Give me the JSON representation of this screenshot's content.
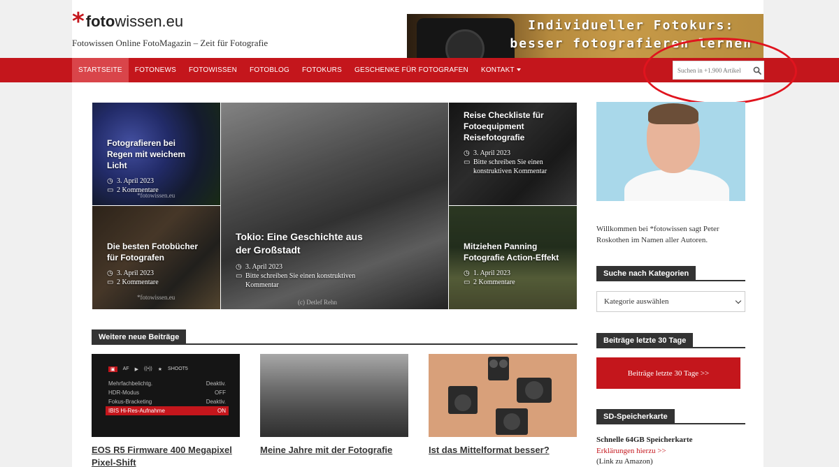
{
  "site": {
    "logo_text": "fotowissen.eu",
    "tagline": "Fotowissen Online FotoMagazin – Zeit für Fotografie"
  },
  "banner": {
    "line1": "Individueller Fotokurs:",
    "line2": "besser fotografieren lernen"
  },
  "nav": {
    "items": [
      {
        "label": "STARTSEITE",
        "active": true
      },
      {
        "label": "FOTONEWS"
      },
      {
        "label": "FOTOWISSEN"
      },
      {
        "label": "FOTOBLOG"
      },
      {
        "label": "FOTOKURS"
      },
      {
        "label": "GESCHENKE FÜR FOTOGRAFEN"
      },
      {
        "label": "KONTAKT"
      }
    ],
    "search_placeholder": "Suchen in +1.900 Artikel"
  },
  "featured": [
    {
      "title": "Fotografieren bei Regen mit weichem Licht",
      "date": "3. April 2023",
      "comments": "2 Kommentare",
      "watermark": "*fotowissen.eu"
    },
    {
      "title": "Die besten Fotobücher für Fotografen",
      "date": "3. April 2023",
      "comments": "2 Kommentare",
      "watermark": "*fotowissen.eu"
    },
    {
      "title": "Tokio: Eine Geschichte aus der Großstadt",
      "date": "3. April 2023",
      "comments": "Bitte schreiben Sie einen konstruktiven Kommentar",
      "watermark": "(c) Detlef Rehn"
    },
    {
      "title": "Reise Checkliste für Fotoequipment Reisefotografie",
      "date": "3. April 2023",
      "comments": "Bitte schreiben Sie einen konstruktiven Kommentar"
    },
    {
      "title": "Mitziehen Panning Fotografie Action-Effekt",
      "date": "1. April 2023",
      "comments": "2 Kommentare"
    }
  ],
  "more_posts": {
    "heading": "Weitere neue Beiträge",
    "cards": [
      {
        "title": "EOS R5 Firmware 400 Megapixel Pixel-Shift"
      },
      {
        "title": "Meine Jahre mit der Fotografie"
      },
      {
        "title": "Ist das Mittelformat besser?"
      }
    ],
    "camera_menu": {
      "tabs": [
        "AF",
        "▶",
        "((•))",
        "★",
        "SHOOT5"
      ],
      "rows": [
        {
          "label": "Mehrfachbelichtg.",
          "value": "Deaktiv."
        },
        {
          "label": "HDR-Modus",
          "value": "OFF"
        },
        {
          "label": "Fokus-Bracketing",
          "value": "Deaktiv."
        },
        {
          "label": "IBIS Hi-Res-Aufnahme",
          "value": "ON",
          "selected": true
        }
      ]
    }
  },
  "sidebar": {
    "welcome": "Willkommen bei *fotowissen sagt Peter Roskothen im Namen aller Autoren.",
    "categories_heading": "Suche nach Kategorien",
    "categories_select": "Kategorie auswählen",
    "recent_heading": "Beiträge letzte 30 Tage",
    "recent_button": "Beiträge letzte 30 Tage >>",
    "sd_heading": "SD-Speicherkarte",
    "sd_title": "Schnelle 64GB Speicherkarte",
    "sd_link": "Erklärungen hierzu >>",
    "sd_note": "(Link zu Amazon)"
  },
  "colors": {
    "brand_red": "#c4161c",
    "dark_label": "#333333"
  }
}
